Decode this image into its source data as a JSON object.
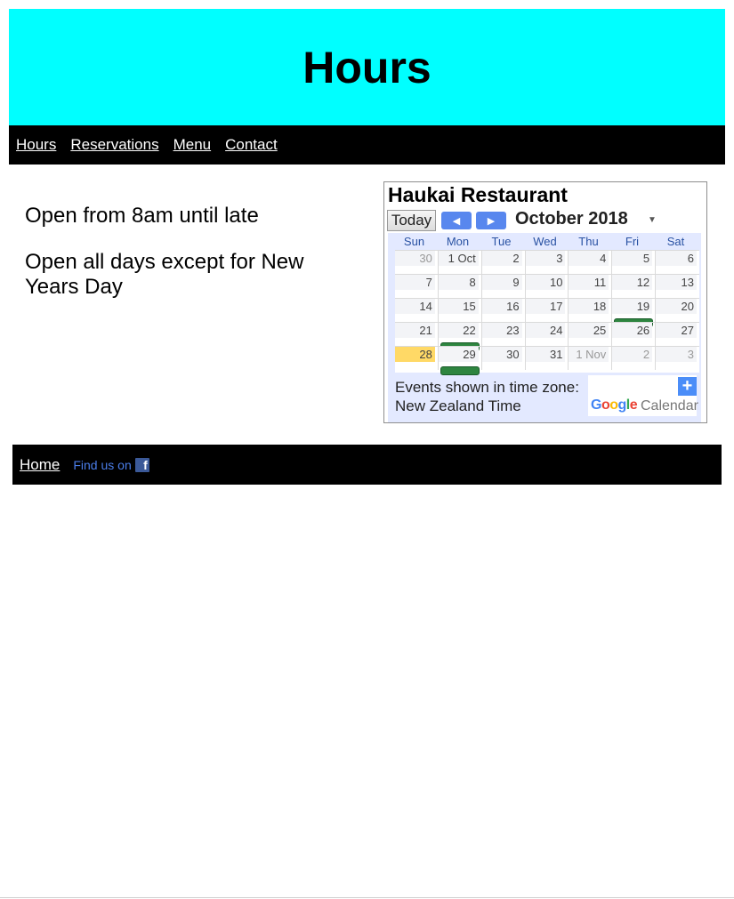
{
  "header": {
    "title": "Hours"
  },
  "nav": {
    "items": [
      "Hours",
      "Reservations",
      "Menu",
      "Contact"
    ]
  },
  "content": {
    "line1": "Open from 8am until late",
    "line2": "Open all days except for New Years Day"
  },
  "calendar": {
    "title": "Haukai Restaurant",
    "today_label": "Today",
    "prev_icon": "left-arrow",
    "next_icon": "right-arrow",
    "month": "October 2018",
    "dropdown_icon": "caret-down",
    "weekdays": [
      "Sun",
      "Mon",
      "Tue",
      "Wed",
      "Thu",
      "Fri",
      "Sat"
    ],
    "weeks": [
      [
        "30",
        "1 Oct",
        "2",
        "3",
        "4",
        "5",
        "6"
      ],
      [
        "7",
        "8",
        "9",
        "10",
        "11",
        "12",
        "13"
      ],
      [
        "14",
        "15",
        "16",
        "17",
        "18",
        "19",
        "20"
      ],
      [
        "21",
        "22",
        "23",
        "24",
        "25",
        "26",
        "27"
      ],
      [
        "28",
        "29",
        "30",
        "31",
        "1 Nov",
        "2",
        "3"
      ]
    ],
    "today_color": "#ffd966",
    "event_color": "#2e8540",
    "timezone_text": "Events shown in time zone: New Zealand Time",
    "google_text": "Google",
    "calendar_text": "Calendar",
    "add_icon": "plus-icon"
  },
  "footer": {
    "home_label": "Home",
    "findus_label": "Find us on",
    "facebook_icon": "facebook-icon"
  }
}
